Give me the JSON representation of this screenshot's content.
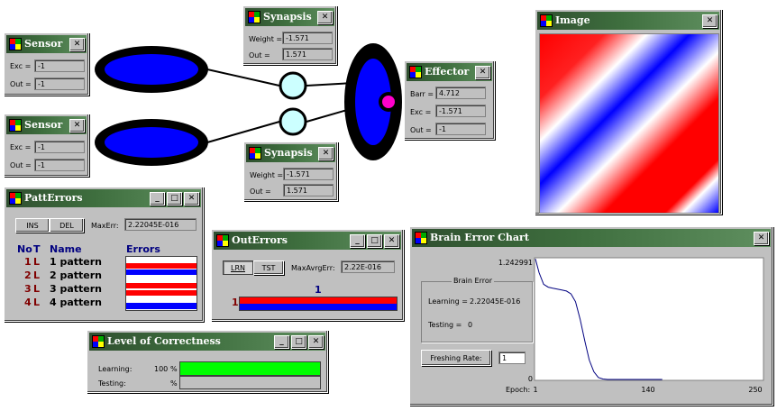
{
  "sensor1": {
    "title": "Sensor",
    "exc_label": "Exc =",
    "exc_value": "-1",
    "out_label": "Out =",
    "out_value": "-1"
  },
  "sensor2": {
    "title": "Sensor",
    "exc_label": "Exc =",
    "exc_value": "-1",
    "out_label": "Out =",
    "out_value": "-1"
  },
  "synapsis1": {
    "title": "Synapsis",
    "weight_label": "Weight =",
    "weight_value": "-1.571",
    "out_label": "Out =",
    "out_value": "1.571"
  },
  "synapsis2": {
    "title": "Synapsis",
    "weight_label": "Weight =",
    "weight_value": "-1.571",
    "out_label": "Out =",
    "out_value": "1.571"
  },
  "effector": {
    "title": "Effector",
    "barr_label": "Barr =",
    "barr_value": "4.712",
    "exc_label": "Exc =",
    "exc_value": "-1.571",
    "out_label": "Out =",
    "out_value": "-1"
  },
  "image": {
    "title": "Image"
  },
  "patterrors": {
    "title": "PattErrors",
    "ins": "INS",
    "del": "DEL",
    "maxerr_label": "MaxErr:",
    "maxerr_value": "2.22045E-016",
    "col_no": "No",
    "col_t": "T",
    "col_name": "Name",
    "col_errors": "Errors",
    "rows": [
      {
        "no": "1",
        "t": "L",
        "name": "1 pattern"
      },
      {
        "no": "2",
        "t": "L",
        "name": "2 pattern"
      },
      {
        "no": "3",
        "t": "L",
        "name": "3 pattern"
      },
      {
        "no": "4",
        "t": "L",
        "name": "4 pattern"
      }
    ]
  },
  "outerrors": {
    "title": "OutErrors",
    "lrn": "LRN",
    "tst": "TST",
    "maxavrg_label": "MaxAvrgErr:",
    "maxavrg_value": "2.22E-016",
    "col": "1",
    "row": "1"
  },
  "correctness": {
    "title": "Level of Correctness",
    "learning_label": "Learning:",
    "learning_pct": "100",
    "pct_sign": "%",
    "testing_label": "Testing:",
    "testing_pct_sign": "%",
    "learning_level": 1.0,
    "testing_level": 0.0
  },
  "brainchart": {
    "title": "Brain Error Chart",
    "group_label": "Brain Error",
    "learning_label": "Learning =",
    "learning_value": "2.22045E-016",
    "testing_label": "Testing =",
    "testing_value": "0",
    "freshing_label": "Freshing Rate:",
    "freshing_value": "1"
  },
  "chart_data": {
    "type": "line",
    "xlabel": "Epoch:",
    "x_ticks": [
      "1",
      "140",
      "250"
    ],
    "y_ticks": [
      "1.242991",
      "0"
    ],
    "xlim": [
      1,
      250
    ],
    "ylim": [
      0,
      1.242991
    ],
    "series": [
      {
        "color": "#000080",
        "x": [
          1,
          5,
          10,
          15,
          20,
          25,
          30,
          35,
          40,
          45,
          50,
          55,
          60,
          65,
          70,
          75,
          80,
          90,
          100,
          120,
          140
        ],
        "y": [
          1.24,
          1.1,
          0.98,
          0.95,
          0.94,
          0.93,
          0.92,
          0.91,
          0.88,
          0.8,
          0.62,
          0.4,
          0.2,
          0.08,
          0.02,
          0.005,
          0,
          0,
          0,
          0,
          0
        ]
      }
    ]
  }
}
